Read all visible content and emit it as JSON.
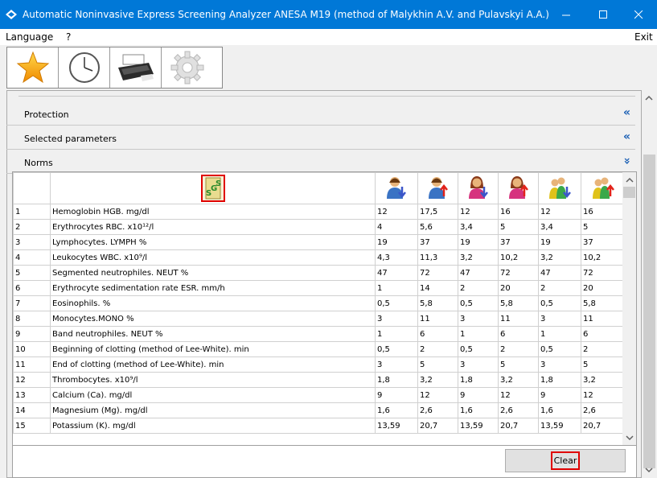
{
  "window": {
    "title": "Automatic Noninvasive Express Screening Analyzer ANESA M19 (method of Malykhin A.V. and Pulavskyi A.A.)"
  },
  "menu": {
    "language": "Language",
    "help": "?",
    "exit": "Exit"
  },
  "sections": [
    {
      "label": "Protection",
      "chevron": "«"
    },
    {
      "label": "Selected parameters",
      "chevron": "«"
    },
    {
      "label": "Norms",
      "chevron": "»"
    }
  ],
  "table": {
    "rows": [
      [
        "1",
        "Hemoglobin HGB. mg/dl",
        "12",
        "17,5",
        "12",
        "16",
        "12",
        "16"
      ],
      [
        "2",
        "Erythrocytes RBC. x10¹²/l",
        "4",
        "5,6",
        "3,4",
        "5",
        "3,4",
        "5"
      ],
      [
        "3",
        "Lymphocytes. LYMPH %",
        "19",
        "37",
        "19",
        "37",
        "19",
        "37"
      ],
      [
        "4",
        "Leukocytes WBC. x10⁹/l",
        "4,3",
        "11,3",
        "3,2",
        "10,2",
        "3,2",
        "10,2"
      ],
      [
        "5",
        "Segmented neutrophiles. NEUT %",
        "47",
        "72",
        "47",
        "72",
        "47",
        "72"
      ],
      [
        "6",
        "Erythrocyte sedimentation rate ESR. mm/h",
        "1",
        "14",
        "2",
        "20",
        "2",
        "20"
      ],
      [
        "7",
        "Eosinophils. %",
        "0,5",
        "5,8",
        "0,5",
        "5,8",
        "0,5",
        "5,8"
      ],
      [
        "8",
        "Monocytes.MONO %",
        "3",
        "11",
        "3",
        "11",
        "3",
        "11"
      ],
      [
        "9",
        "Band neutrophiles. NEUT %",
        "1",
        "6",
        "1",
        "6",
        "1",
        "6"
      ],
      [
        "10",
        "Beginning of clotting (method of Lee-White). min",
        "0,5",
        "2",
        "0,5",
        "2",
        "0,5",
        "2"
      ],
      [
        "11",
        "End of clotting (method of Lee-White). min",
        "3",
        "5",
        "3",
        "5",
        "3",
        "5"
      ],
      [
        "12",
        "Thrombocytes. x10⁹/l",
        "1,8",
        "3,2",
        "1,8",
        "3,2",
        "1,8",
        "3,2"
      ],
      [
        "13",
        "Calcium (Ca). mg/dl",
        "9",
        "12",
        "9",
        "12",
        "9",
        "12"
      ],
      [
        "14",
        "Magnesium (Mg). mg/dl",
        "1,6",
        "2,6",
        "1,6",
        "2,6",
        "1,6",
        "2,6"
      ],
      [
        "15",
        "Potassium (K). mg/dl",
        "13,59",
        "20,7",
        "13,59",
        "20,7",
        "13,59",
        "20,7"
      ]
    ]
  },
  "clear_button": {
    "label": "Clear"
  },
  "colors": {
    "titlebar": "#0078d7",
    "accent_red": "#e00000"
  }
}
